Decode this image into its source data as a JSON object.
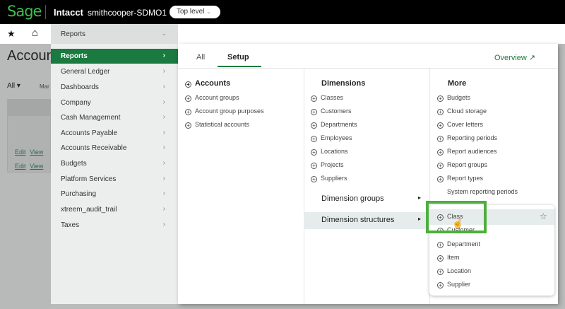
{
  "topbar": {
    "logo": "Sage",
    "app": "Intacct",
    "company": "smithcooper-SDMO1",
    "level": "Top level"
  },
  "subbar": {
    "current": "Reports"
  },
  "page": {
    "title": "Accoun",
    "filter": "All ▾",
    "col": "Mar",
    "rows": [
      {
        "edit": "Edit",
        "view": "View"
      },
      {
        "edit": "Edit",
        "view": "View"
      }
    ]
  },
  "menu": [
    "Reports",
    "General Ledger",
    "Dashboards",
    "Company",
    "Cash Management",
    "Accounts Payable",
    "Accounts Receivable",
    "Budgets",
    "Platform Services",
    "Purchasing",
    "xtreem_audit_trail",
    "Taxes"
  ],
  "tabs": {
    "all": "All",
    "setup": "Setup",
    "overview": "Overview"
  },
  "accounts": {
    "title": "Accounts",
    "items": [
      "Account groups",
      "Account group purposes",
      "Statistical accounts"
    ]
  },
  "dimensions": {
    "title": "Dimensions",
    "items": [
      "Classes",
      "Customers",
      "Departments",
      "Employees",
      "Locations",
      "Projects",
      "Suppliers"
    ],
    "groups": "Dimension groups",
    "structures": "Dimension structures"
  },
  "more": {
    "title": "More",
    "items": [
      "Budgets",
      "Cloud storage",
      "Cover letters",
      "Reporting periods",
      "Report audiences",
      "Report groups",
      "Report types"
    ],
    "system": "System reporting periods"
  },
  "submenu": [
    "Class",
    "Customer",
    "Department",
    "Item",
    "Location",
    "Supplier"
  ]
}
